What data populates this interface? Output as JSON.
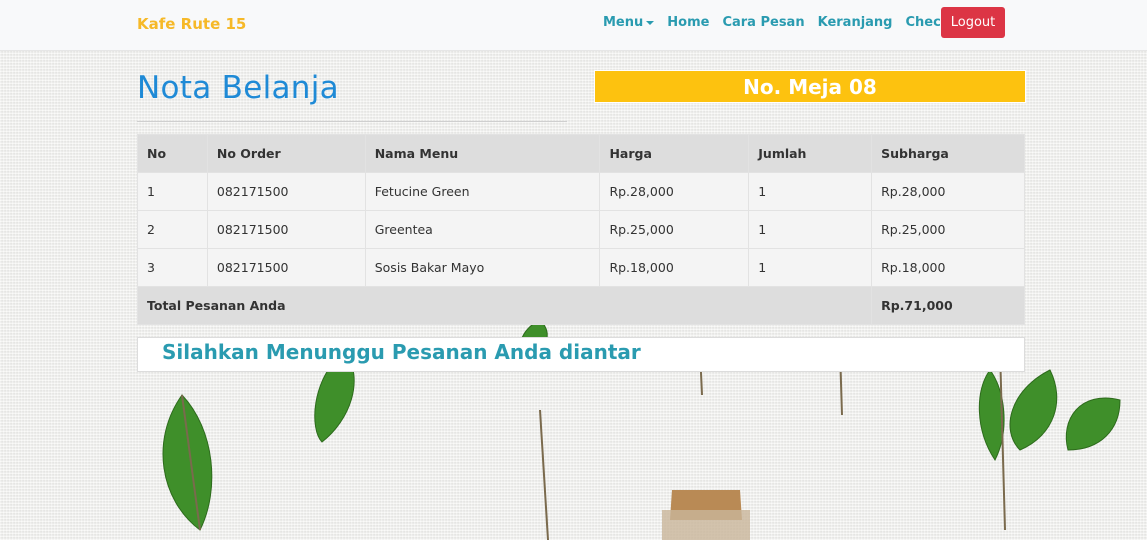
{
  "nav": {
    "brand": "Kafe Rute 15",
    "links": [
      "Menu",
      "Home",
      "Cara Pesan",
      "Keranjang",
      "Checkout"
    ],
    "logout": "Logout"
  },
  "page": {
    "title": "Nota Belanja",
    "table_label": "No. Meja 08",
    "notice": "Silahkan Menunggu Pesanan Anda diantar"
  },
  "table": {
    "headers": [
      "No",
      "No Order",
      "Nama Menu",
      "Harga",
      "Jumlah",
      "Subharga"
    ],
    "rows": [
      [
        "1",
        "082171500",
        "Fetucine Green",
        "Rp.28,000",
        "1",
        "Rp.28,000"
      ],
      [
        "2",
        "082171500",
        "Greentea",
        "Rp.25,000",
        "1",
        "Rp.25,000"
      ],
      [
        "3",
        "082171500",
        "Sosis Bakar Mayo",
        "Rp.18,000",
        "1",
        "Rp.18,000"
      ]
    ],
    "total_label": "Total Pesanan Anda",
    "total_value": "Rp.71,000"
  },
  "colors": {
    "brand": "#f6b928",
    "nav_link": "#2a9bb0",
    "logout": "#dc3545",
    "title": "#1f8ad6",
    "meja_bg": "#fdc20f"
  }
}
